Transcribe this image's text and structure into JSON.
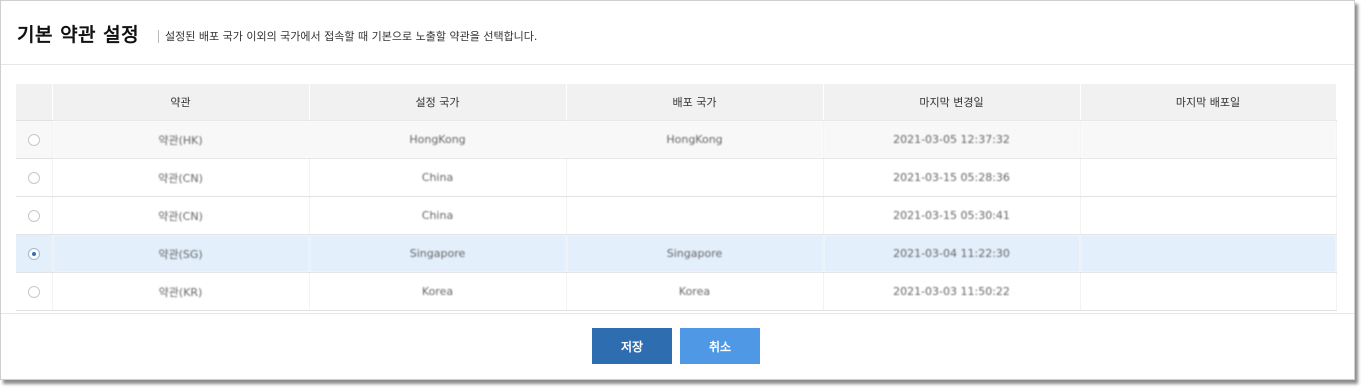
{
  "dialog": {
    "title": "기본 약관 설정",
    "subtitle": "설정된 배포 국가 이외의 국가에서 접속할 때 기본으로 노출할 약관을 선택합니다."
  },
  "table": {
    "columns": [
      "약관",
      "설정 국가",
      "배포 국가",
      "마지막 변경일",
      "마지막 배포일"
    ],
    "rows": [
      {
        "selected": false,
        "terms": "약관(HK)",
        "setting_country": "HongKong",
        "deploy_country": "HongKong",
        "last_modified": "2021-03-05 12:37:32",
        "last_deployed": ""
      },
      {
        "selected": false,
        "terms": "약관(CN)",
        "setting_country": "China",
        "deploy_country": "",
        "last_modified": "2021-03-15 05:28:36",
        "last_deployed": ""
      },
      {
        "selected": false,
        "terms": "약관(CN)",
        "setting_country": "China",
        "deploy_country": "",
        "last_modified": "2021-03-15 05:30:41",
        "last_deployed": ""
      },
      {
        "selected": true,
        "terms": "약관(SG)",
        "setting_country": "Singapore",
        "deploy_country": "Singapore",
        "last_modified": "2021-03-04 11:22:30",
        "last_deployed": ""
      },
      {
        "selected": false,
        "terms": "약관(KR)",
        "setting_country": "Korea",
        "deploy_country": "Korea",
        "last_modified": "2021-03-03 11:50:22",
        "last_deployed": ""
      }
    ]
  },
  "footer": {
    "save_label": "저장",
    "cancel_label": "취소"
  },
  "colors": {
    "save_button": "#2f6db1",
    "cancel_button": "#4f98e6",
    "selected_row": "#e3effb"
  }
}
